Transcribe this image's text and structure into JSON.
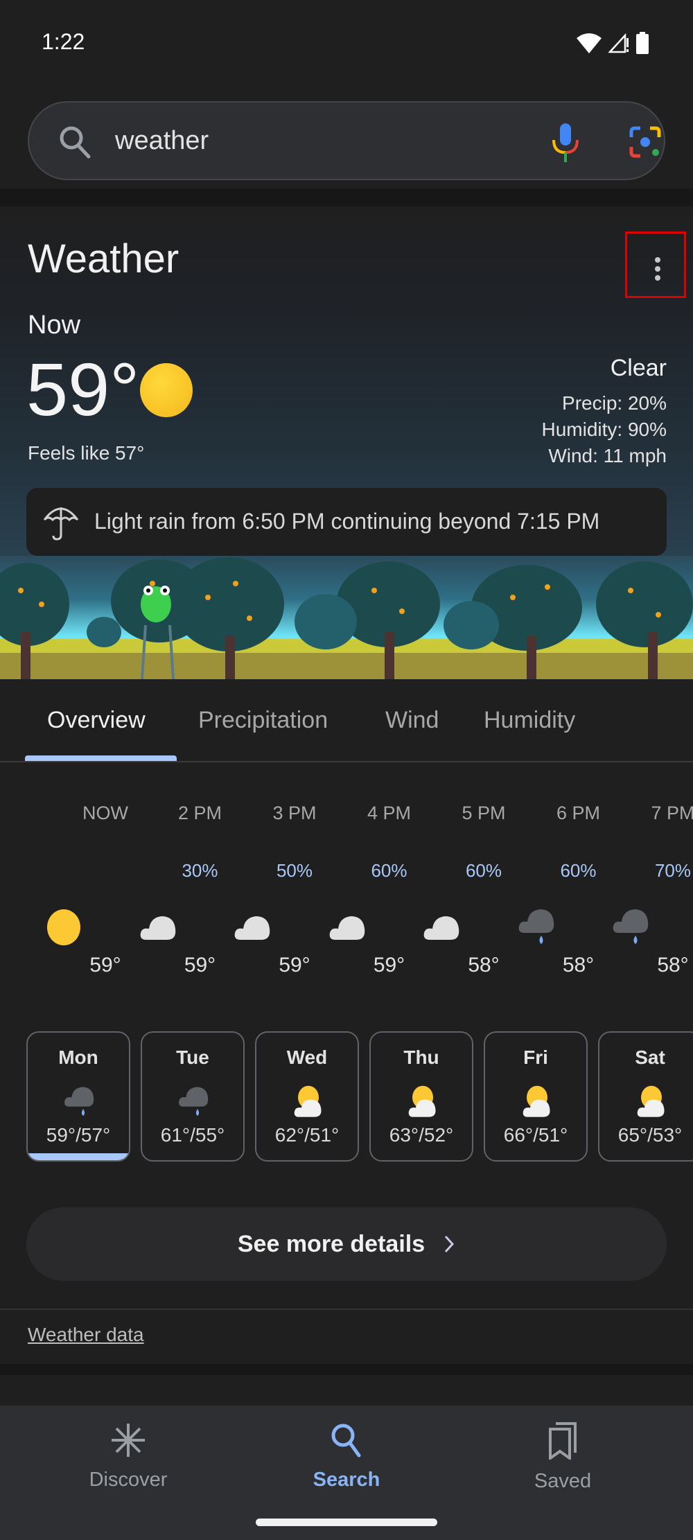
{
  "status_bar": {
    "time": "1:22",
    "icons": [
      "wifi-icon",
      "cell-signal-icon",
      "battery-icon"
    ]
  },
  "search": {
    "query": "weather",
    "icons": [
      "search-icon",
      "mic-icon",
      "lens-icon"
    ]
  },
  "weather": {
    "title": "Weather",
    "now_label": "Now",
    "temperature": "59°",
    "current_icon": "sun-icon",
    "feels_like": "Feels like 57°",
    "condition": "Clear",
    "precip": "Precip: 20%",
    "humidity": "Humidity: 90%",
    "wind": "Wind: 11 mph",
    "alert": {
      "icon": "umbrella-icon",
      "text": "Light rain from 6:50 PM continuing beyond 7:15 PM"
    },
    "more_options_icon": "more-vert-icon"
  },
  "tabs": [
    {
      "label": "Overview",
      "active": true
    },
    {
      "label": "Precipitation",
      "active": false
    },
    {
      "label": "Wind",
      "active": false
    },
    {
      "label": "Humidity",
      "active": false
    }
  ],
  "hourly": [
    {
      "time": "NOW",
      "precip": "",
      "icon": "sun",
      "temp": "59°"
    },
    {
      "time": "2 PM",
      "precip": "30%",
      "icon": "cloud",
      "temp": "59°"
    },
    {
      "time": "3 PM",
      "precip": "50%",
      "icon": "cloud",
      "temp": "59°"
    },
    {
      "time": "4 PM",
      "precip": "60%",
      "icon": "cloud",
      "temp": "59°"
    },
    {
      "time": "5 PM",
      "precip": "60%",
      "icon": "cloud",
      "temp": "58°"
    },
    {
      "time": "6 PM",
      "precip": "60%",
      "icon": "rain",
      "temp": "58°"
    },
    {
      "time": "7 PM",
      "precip": "70%",
      "icon": "rain",
      "temp": "58°"
    }
  ],
  "daily": [
    {
      "day": "Mon",
      "icon": "rain",
      "temps": "59°/57°",
      "selected": true
    },
    {
      "day": "Tue",
      "icon": "rain",
      "temps": "61°/55°",
      "selected": false
    },
    {
      "day": "Wed",
      "icon": "partly-cloudy",
      "temps": "62°/51°",
      "selected": false
    },
    {
      "day": "Thu",
      "icon": "partly-cloudy",
      "temps": "63°/52°",
      "selected": false
    },
    {
      "day": "Fri",
      "icon": "partly-cloudy",
      "temps": "66°/51°",
      "selected": false
    },
    {
      "day": "Sat",
      "icon": "partly-cloudy",
      "temps": "65°/53°",
      "selected": false
    }
  ],
  "see_more": {
    "label": "See more details"
  },
  "weather_data_link": "Weather data",
  "bottom_nav": [
    {
      "label": "Discover",
      "icon": "discover-icon",
      "active": false
    },
    {
      "label": "Search",
      "icon": "search-icon",
      "active": true
    },
    {
      "label": "Saved",
      "icon": "saved-icon",
      "active": false
    }
  ],
  "colors": {
    "accent": "#8ab4f8",
    "tab_indicator": "#a8c7fa",
    "precip": "#a8c7fa",
    "highlight_box": "#e00000"
  }
}
